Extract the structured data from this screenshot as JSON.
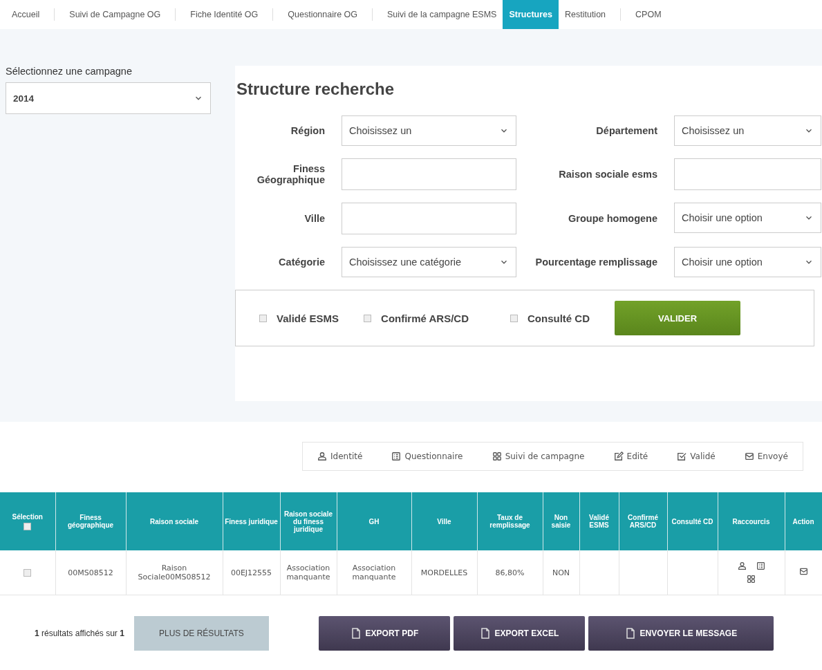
{
  "nav": [
    {
      "label": "Accueil",
      "selected": false
    },
    {
      "label": "Suivi de Campagne OG",
      "selected": false
    },
    {
      "label": "Fiche Identité OG",
      "selected": false
    },
    {
      "label": "Questionnaire OG",
      "selected": false
    },
    {
      "label": "Suivi de la campagne ESMS",
      "selected": false
    },
    {
      "label": "Structures",
      "selected": true
    },
    {
      "label": "Restitution",
      "selected": false
    },
    {
      "label": "CPOM",
      "selected": false
    }
  ],
  "campaign": {
    "label": "Sélectionnez une campagne",
    "value": "2014"
  },
  "search": {
    "title": "Structure recherche",
    "fields": [
      {
        "label": "Région",
        "kind": "select",
        "value": "Choisissez un"
      },
      {
        "label": "Département",
        "kind": "select",
        "value": "Choisissez un"
      },
      {
        "label": "Finess Géographique",
        "kind": "text"
      },
      {
        "label": "Raison sociale esms",
        "kind": "text"
      },
      {
        "label": "Ville",
        "kind": "text"
      },
      {
        "label": "Groupe homogene",
        "kind": "select",
        "value": "Choisir une option"
      },
      {
        "label": "Catégorie",
        "kind": "select",
        "value": "Choisissez une catégorie"
      },
      {
        "label": "Pourcentage remplissage",
        "kind": "select",
        "value": "Choisir une option"
      }
    ],
    "checkboxes": [
      {
        "label": "Validé ESMS",
        "checked": false
      },
      {
        "label": "Confirmé ARS/CD",
        "checked": false
      },
      {
        "label": "Consulté CD",
        "checked": false
      }
    ],
    "submit": "VALIDER"
  },
  "legend": [
    {
      "label": "Identité",
      "kind": "person"
    },
    {
      "label": "Questionnaire",
      "kind": "list"
    },
    {
      "label": "Suivi de campagne",
      "kind": "grid"
    },
    {
      "label": "Edité",
      "kind": "edit"
    },
    {
      "label": "Validé",
      "kind": "check"
    },
    {
      "label": "Envoyé",
      "kind": "mail"
    }
  ],
  "table": {
    "columns": [
      {
        "label": "Sélection",
        "kind": "select",
        "checked": false
      },
      {
        "label": "Finess géographique",
        "kind": "text"
      },
      {
        "label": "Raison sociale",
        "kind": "text"
      },
      {
        "label": "Finess juridique",
        "kind": "text"
      },
      {
        "label": "Raison sociale du finess juridique",
        "kind": "text"
      },
      {
        "label": "GH",
        "kind": "text"
      },
      {
        "label": "Ville",
        "kind": "text"
      },
      {
        "label": "Taux de remplissage",
        "kind": "text"
      },
      {
        "label": "Non saisie",
        "kind": "text"
      },
      {
        "label": "Validé ESMS",
        "kind": "text"
      },
      {
        "label": "Confirmé ARS/CD",
        "kind": "text"
      },
      {
        "label": "Consulté CD",
        "kind": "text"
      },
      {
        "label": "Raccourcis",
        "kind": "shortcuts"
      },
      {
        "label": "Action",
        "kind": "action"
      }
    ],
    "rows": [
      {
        "checked": false,
        "cells": [
          "",
          "00MS08512",
          "Raison Sociale00MS08512",
          "00EJ12555",
          "Association manquante",
          "Association manquante",
          "MORDELLES",
          "86,80%",
          "NON"
        ]
      }
    ]
  },
  "footer": {
    "count": "**1** résultats affichés sur **1**",
    "buttons": [
      {
        "label": "PLUS DE RÉSULTATS",
        "kind": "secondary"
      },
      {
        "label": "EXPORT PDF",
        "kind": "export"
      },
      {
        "label": "EXPORT EXCEL",
        "kind": "export"
      },
      {
        "label": "ENVOYER LE MESSAGE",
        "kind": "export"
      }
    ]
  }
}
